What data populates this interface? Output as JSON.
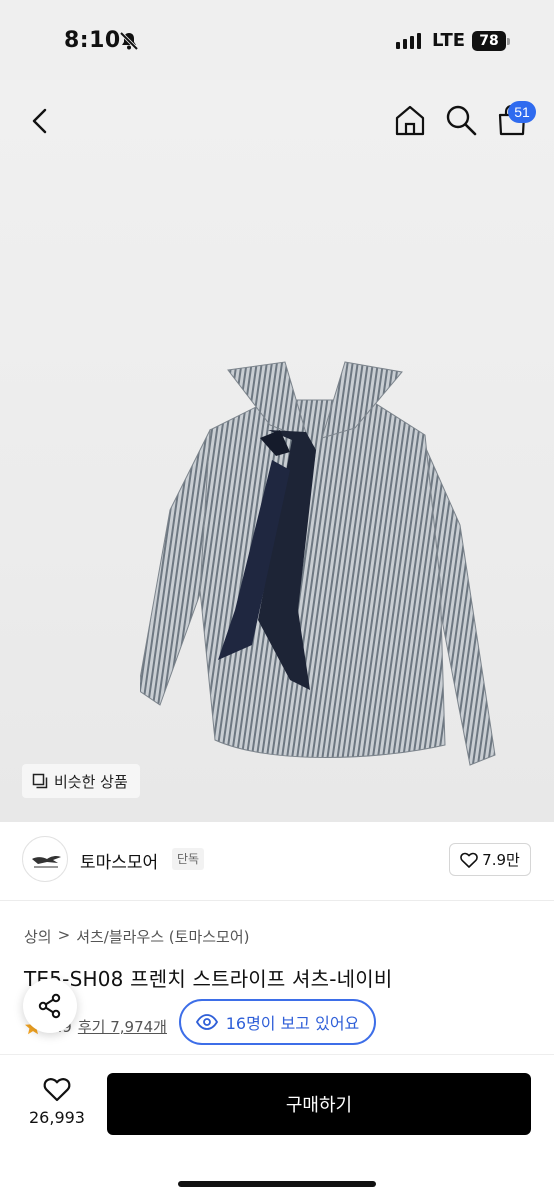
{
  "status_bar": {
    "time": "8:10",
    "network": "LTE",
    "battery": "78"
  },
  "header": {
    "cart_count": "51"
  },
  "hero": {
    "similar_button": "비슷한 상품"
  },
  "brand": {
    "name": "토마스모어",
    "tag": "단독",
    "likes": "7.9만"
  },
  "product": {
    "breadcrumb": [
      "상의",
      ">",
      "셔츠/블라우스 (토마스모어)"
    ],
    "title": "TE5-SH08 프렌치 스트라이프 셔츠-네이비",
    "rating": "4.9",
    "reviews": "후기 7,974개",
    "viewers": "16명이 보고 있어요"
  },
  "bottom": {
    "wish_count": "26,993",
    "buy_label": "구매하기"
  },
  "colors": {
    "accent": "#2f6bef",
    "buy_button": "#000000",
    "star": "#f5a623"
  }
}
